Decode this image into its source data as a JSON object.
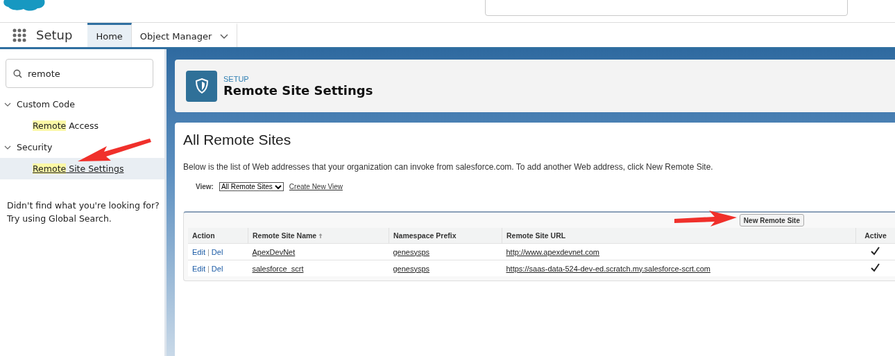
{
  "nav": {
    "app_name": "Setup",
    "tabs": [
      {
        "label": "Home",
        "selected": true,
        "menu": false
      },
      {
        "label": "Object Manager",
        "selected": false,
        "menu": true
      }
    ]
  },
  "sidebar": {
    "search": {
      "value": "remote"
    },
    "tree": [
      {
        "label": "Custom Code",
        "expanded": true,
        "children": [
          {
            "match": "Remote",
            "rest": " Access",
            "selected": false
          }
        ]
      },
      {
        "label": "Security",
        "expanded": true,
        "children": [
          {
            "match": "Remote",
            "rest": " Site Settings",
            "selected": true
          }
        ]
      }
    ],
    "help": [
      "Didn't find what you're looking for?",
      "Try using Global Search."
    ]
  },
  "page_header": {
    "eyebrow": "SETUP",
    "title": "Remote Site Settings"
  },
  "list": {
    "title": "All Remote Sites",
    "description": "Below is the list of Web addresses that your organization can invoke from salesforce.com. To add another Web address, click New Remote Site.",
    "view_label": "View:",
    "view_value": "All Remote Sites",
    "create_view": "Create New View",
    "new_button": "New Remote Site",
    "columns": [
      "Action",
      "Remote Site Name",
      "Namespace Prefix",
      "Remote Site URL",
      "Active"
    ],
    "rows": [
      {
        "edit": "Edit",
        "sep": "|",
        "del": "Del",
        "name": "ApexDevNet",
        "namespace": "genesysps",
        "url": "http://www.apexdevnet.com",
        "active": true
      },
      {
        "edit": "Edit",
        "sep": "|",
        "del": "Del",
        "name": "salesforce_scrt",
        "namespace": "genesysps",
        "url": "https://saas-data-524-dev-ed.scratch.my.salesforce-scrt.com",
        "active": true
      }
    ]
  }
}
